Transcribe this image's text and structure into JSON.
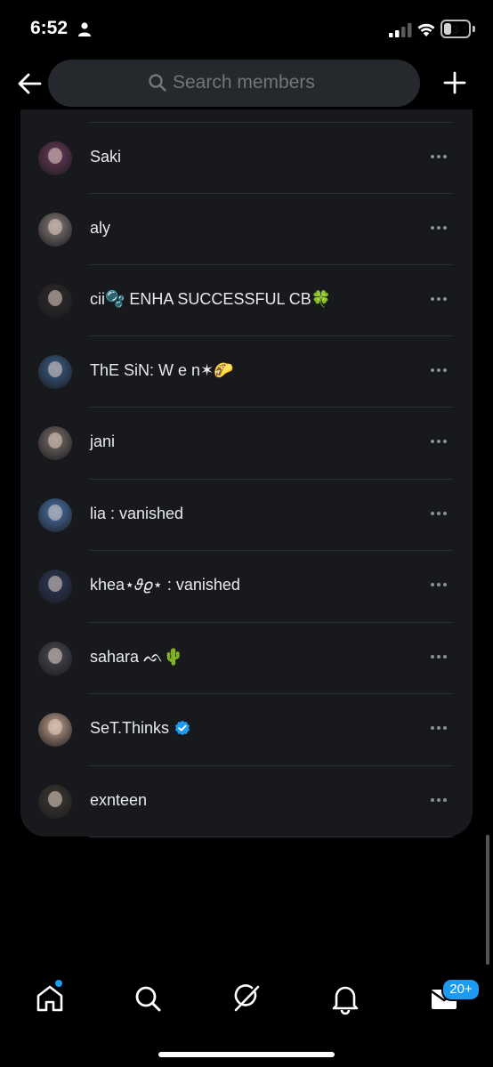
{
  "status_bar": {
    "time": "6:52",
    "battery": "3",
    "battery_level": 0.3
  },
  "header": {
    "search_placeholder": "Search members"
  },
  "members": [
    {
      "name": "Saki",
      "avatar_color": "#6d3a5a"
    },
    {
      "name": "aly",
      "avatar_color": "#8a7f7a"
    },
    {
      "name": "cii🫧 ENHA SUCCESSFUL CB🍀",
      "avatar_color": "#2f2a2a"
    },
    {
      "name": "ThE SiN: W e n✶🌮",
      "avatar_color": "#3a5f8a"
    },
    {
      "name": "jani",
      "avatar_color": "#7b7068"
    },
    {
      "name": "lia : vanished",
      "avatar_color": "#4a78b0"
    },
    {
      "name": "khea⋆𝜗𝜚⋆ : vanished",
      "avatar_color": "#2d3a5a"
    },
    {
      "name": "sahara ᨒ🌵",
      "avatar_color": "#4b4b55"
    },
    {
      "name": "SeT.Thinks",
      "avatar_color": "#c8a690",
      "verified": true
    },
    {
      "name": "exnteen",
      "avatar_color": "#3d3a30"
    }
  ],
  "tab_bar": {
    "messages_badge": "20+"
  },
  "colors": {
    "accent": "#1d9bf0",
    "panel": "#17191d",
    "search_bg": "#25292e"
  }
}
